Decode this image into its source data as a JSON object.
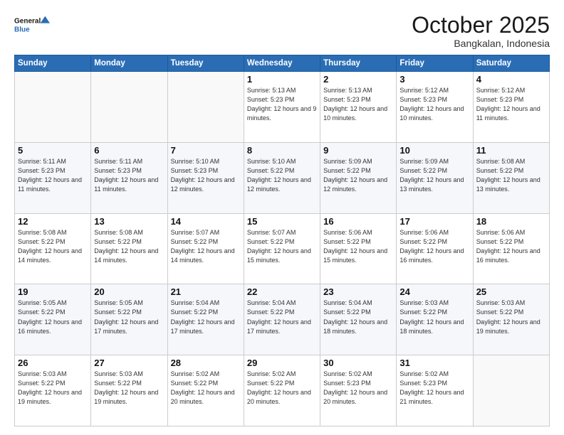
{
  "logo": {
    "line1": "General",
    "line2": "Blue"
  },
  "header": {
    "title": "October 2025",
    "subtitle": "Bangkalan, Indonesia"
  },
  "weekdays": [
    "Sunday",
    "Monday",
    "Tuesday",
    "Wednesday",
    "Thursday",
    "Friday",
    "Saturday"
  ],
  "weeks": [
    [
      {
        "day": "",
        "sunrise": "",
        "sunset": "",
        "daylight": ""
      },
      {
        "day": "",
        "sunrise": "",
        "sunset": "",
        "daylight": ""
      },
      {
        "day": "",
        "sunrise": "",
        "sunset": "",
        "daylight": ""
      },
      {
        "day": "1",
        "sunrise": "Sunrise: 5:13 AM",
        "sunset": "Sunset: 5:23 PM",
        "daylight": "Daylight: 12 hours and 9 minutes."
      },
      {
        "day": "2",
        "sunrise": "Sunrise: 5:13 AM",
        "sunset": "Sunset: 5:23 PM",
        "daylight": "Daylight: 12 hours and 10 minutes."
      },
      {
        "day": "3",
        "sunrise": "Sunrise: 5:12 AM",
        "sunset": "Sunset: 5:23 PM",
        "daylight": "Daylight: 12 hours and 10 minutes."
      },
      {
        "day": "4",
        "sunrise": "Sunrise: 5:12 AM",
        "sunset": "Sunset: 5:23 PM",
        "daylight": "Daylight: 12 hours and 11 minutes."
      }
    ],
    [
      {
        "day": "5",
        "sunrise": "Sunrise: 5:11 AM",
        "sunset": "Sunset: 5:23 PM",
        "daylight": "Daylight: 12 hours and 11 minutes."
      },
      {
        "day": "6",
        "sunrise": "Sunrise: 5:11 AM",
        "sunset": "Sunset: 5:23 PM",
        "daylight": "Daylight: 12 hours and 11 minutes."
      },
      {
        "day": "7",
        "sunrise": "Sunrise: 5:10 AM",
        "sunset": "Sunset: 5:23 PM",
        "daylight": "Daylight: 12 hours and 12 minutes."
      },
      {
        "day": "8",
        "sunrise": "Sunrise: 5:10 AM",
        "sunset": "Sunset: 5:22 PM",
        "daylight": "Daylight: 12 hours and 12 minutes."
      },
      {
        "day": "9",
        "sunrise": "Sunrise: 5:09 AM",
        "sunset": "Sunset: 5:22 PM",
        "daylight": "Daylight: 12 hours and 12 minutes."
      },
      {
        "day": "10",
        "sunrise": "Sunrise: 5:09 AM",
        "sunset": "Sunset: 5:22 PM",
        "daylight": "Daylight: 12 hours and 13 minutes."
      },
      {
        "day": "11",
        "sunrise": "Sunrise: 5:08 AM",
        "sunset": "Sunset: 5:22 PM",
        "daylight": "Daylight: 12 hours and 13 minutes."
      }
    ],
    [
      {
        "day": "12",
        "sunrise": "Sunrise: 5:08 AM",
        "sunset": "Sunset: 5:22 PM",
        "daylight": "Daylight: 12 hours and 14 minutes."
      },
      {
        "day": "13",
        "sunrise": "Sunrise: 5:08 AM",
        "sunset": "Sunset: 5:22 PM",
        "daylight": "Daylight: 12 hours and 14 minutes."
      },
      {
        "day": "14",
        "sunrise": "Sunrise: 5:07 AM",
        "sunset": "Sunset: 5:22 PM",
        "daylight": "Daylight: 12 hours and 14 minutes."
      },
      {
        "day": "15",
        "sunrise": "Sunrise: 5:07 AM",
        "sunset": "Sunset: 5:22 PM",
        "daylight": "Daylight: 12 hours and 15 minutes."
      },
      {
        "day": "16",
        "sunrise": "Sunrise: 5:06 AM",
        "sunset": "Sunset: 5:22 PM",
        "daylight": "Daylight: 12 hours and 15 minutes."
      },
      {
        "day": "17",
        "sunrise": "Sunrise: 5:06 AM",
        "sunset": "Sunset: 5:22 PM",
        "daylight": "Daylight: 12 hours and 16 minutes."
      },
      {
        "day": "18",
        "sunrise": "Sunrise: 5:06 AM",
        "sunset": "Sunset: 5:22 PM",
        "daylight": "Daylight: 12 hours and 16 minutes."
      }
    ],
    [
      {
        "day": "19",
        "sunrise": "Sunrise: 5:05 AM",
        "sunset": "Sunset: 5:22 PM",
        "daylight": "Daylight: 12 hours and 16 minutes."
      },
      {
        "day": "20",
        "sunrise": "Sunrise: 5:05 AM",
        "sunset": "Sunset: 5:22 PM",
        "daylight": "Daylight: 12 hours and 17 minutes."
      },
      {
        "day": "21",
        "sunrise": "Sunrise: 5:04 AM",
        "sunset": "Sunset: 5:22 PM",
        "daylight": "Daylight: 12 hours and 17 minutes."
      },
      {
        "day": "22",
        "sunrise": "Sunrise: 5:04 AM",
        "sunset": "Sunset: 5:22 PM",
        "daylight": "Daylight: 12 hours and 17 minutes."
      },
      {
        "day": "23",
        "sunrise": "Sunrise: 5:04 AM",
        "sunset": "Sunset: 5:22 PM",
        "daylight": "Daylight: 12 hours and 18 minutes."
      },
      {
        "day": "24",
        "sunrise": "Sunrise: 5:03 AM",
        "sunset": "Sunset: 5:22 PM",
        "daylight": "Daylight: 12 hours and 18 minutes."
      },
      {
        "day": "25",
        "sunrise": "Sunrise: 5:03 AM",
        "sunset": "Sunset: 5:22 PM",
        "daylight": "Daylight: 12 hours and 19 minutes."
      }
    ],
    [
      {
        "day": "26",
        "sunrise": "Sunrise: 5:03 AM",
        "sunset": "Sunset: 5:22 PM",
        "daylight": "Daylight: 12 hours and 19 minutes."
      },
      {
        "day": "27",
        "sunrise": "Sunrise: 5:03 AM",
        "sunset": "Sunset: 5:22 PM",
        "daylight": "Daylight: 12 hours and 19 minutes."
      },
      {
        "day": "28",
        "sunrise": "Sunrise: 5:02 AM",
        "sunset": "Sunset: 5:22 PM",
        "daylight": "Daylight: 12 hours and 20 minutes."
      },
      {
        "day": "29",
        "sunrise": "Sunrise: 5:02 AM",
        "sunset": "Sunset: 5:22 PM",
        "daylight": "Daylight: 12 hours and 20 minutes."
      },
      {
        "day": "30",
        "sunrise": "Sunrise: 5:02 AM",
        "sunset": "Sunset: 5:23 PM",
        "daylight": "Daylight: 12 hours and 20 minutes."
      },
      {
        "day": "31",
        "sunrise": "Sunrise: 5:02 AM",
        "sunset": "Sunset: 5:23 PM",
        "daylight": "Daylight: 12 hours and 21 minutes."
      },
      {
        "day": "",
        "sunrise": "",
        "sunset": "",
        "daylight": ""
      }
    ]
  ]
}
